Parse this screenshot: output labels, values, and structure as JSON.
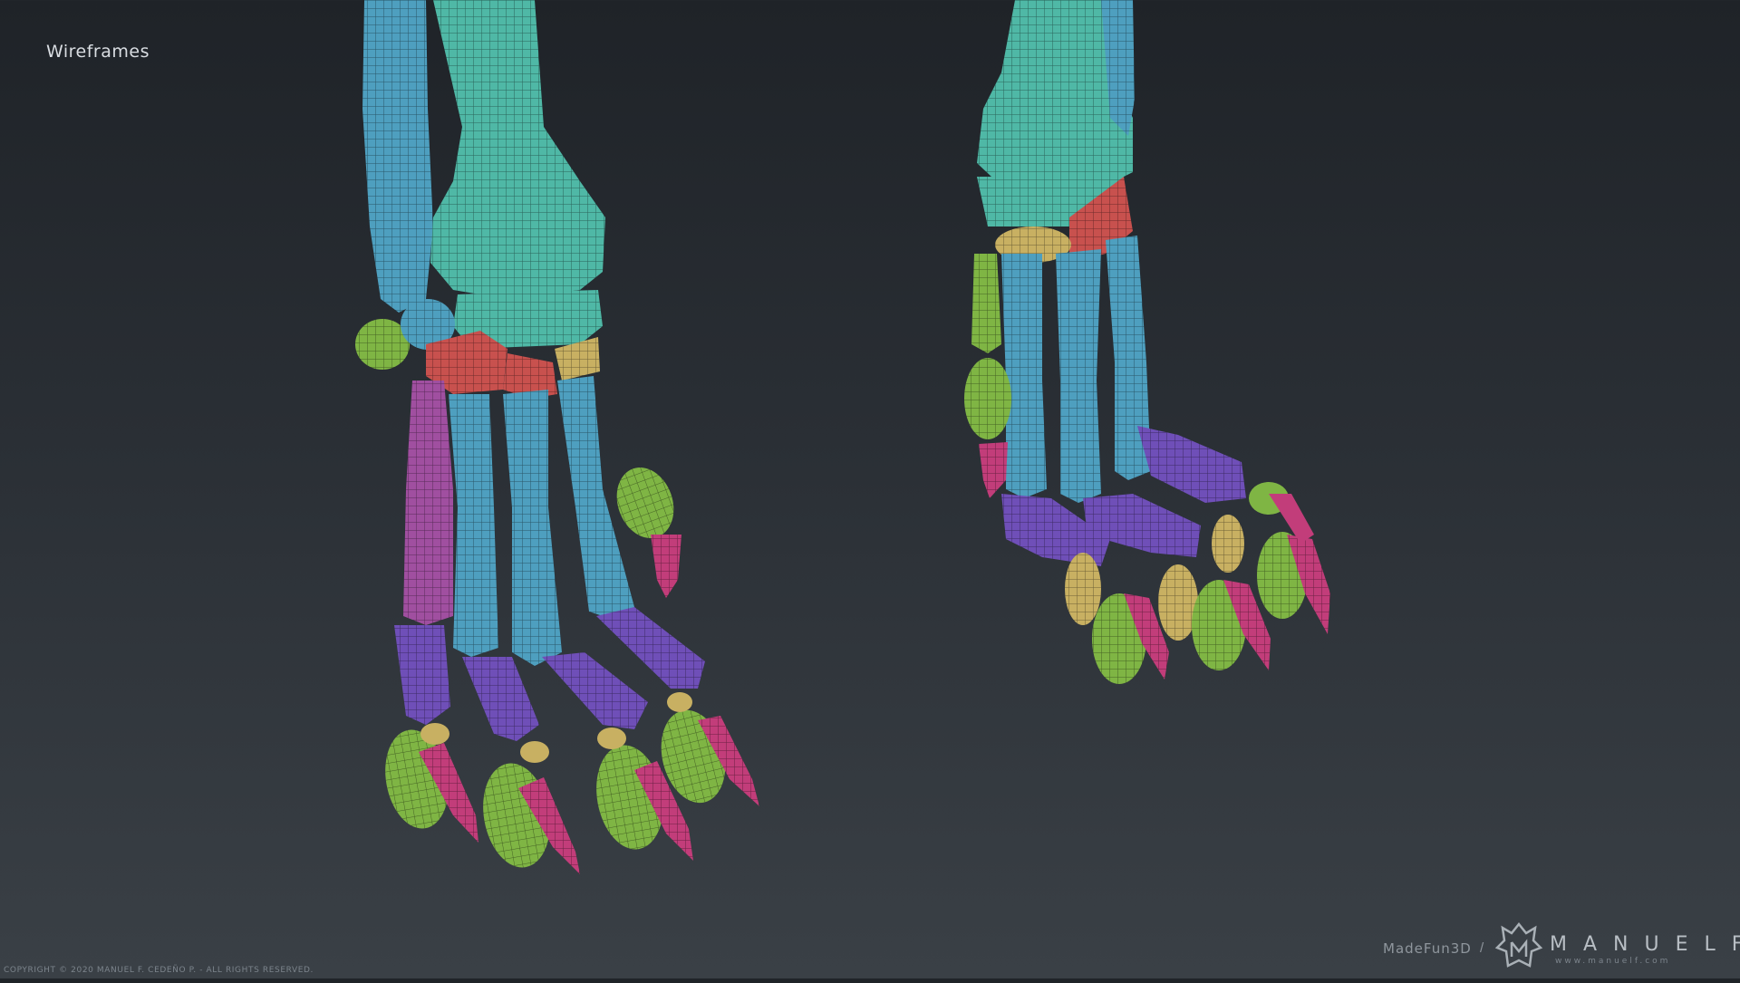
{
  "header": {
    "title": "Wireframes"
  },
  "footer": {
    "copyright": "COPYRIGHT © 2020 MANUEL F. CEDEÑO P. - ALL RIGHTS RESERVED."
  },
  "branding": {
    "madefun": "MadeFun3D",
    "separator": "/",
    "name": "MANUELF",
    "url": "www.manuelf.com"
  },
  "colors": {
    "background_top": "#1f2328",
    "background_bottom": "#3a4046",
    "teal_bone": "#4fb8a6",
    "blue_bone": "#4e9fbf",
    "red_carpal": "#c8514e",
    "tan_bone": "#c8b062",
    "green_phalanx": "#7fb544",
    "purple_metacarpal": "#6f4fb8",
    "magenta_bone": "#a04fa0",
    "pink_claw": "#c23d7a"
  },
  "icons": [
    "manuelf-logo-icon"
  ]
}
